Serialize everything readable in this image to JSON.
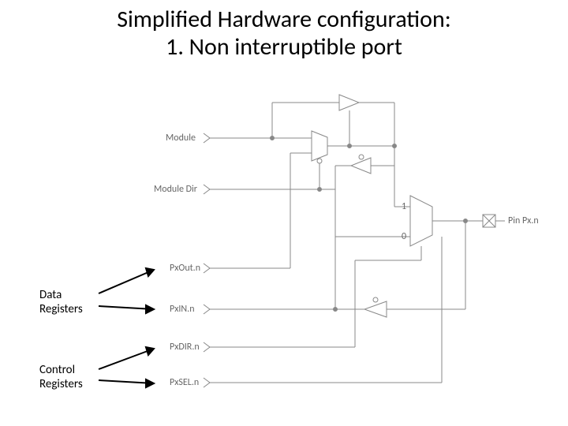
{
  "title_line1": "Simplified Hardware configuration:",
  "title_line2": "1.  Non interruptible port",
  "labels": {
    "module": "Module",
    "module_dir": "Module Dir",
    "pxout": "PxOut.n",
    "pxin": "PxIN.n",
    "pxdir": "PxDIR.n",
    "pxsel": "PxSEL.n",
    "pin": "Pin Px.n",
    "mux1": "1",
    "mux0": "0"
  },
  "annotations": {
    "data_registers": "Data\nRegisters",
    "control_registers": "Control\nRegisters"
  }
}
